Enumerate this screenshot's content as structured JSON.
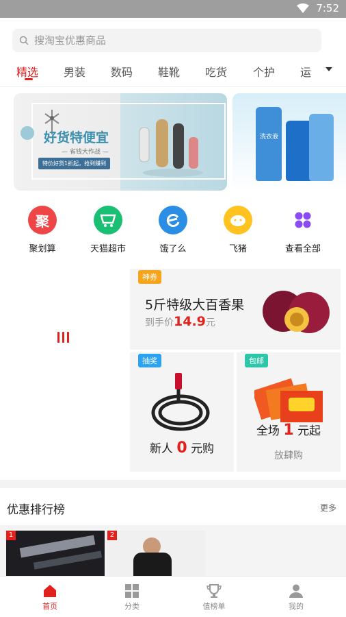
{
  "status_bar": {
    "time": "7:52"
  },
  "search": {
    "placeholder": "搜淘宝优惠商品"
  },
  "tabs": [
    {
      "label": "精选"
    },
    {
      "label": "男装"
    },
    {
      "label": "数码"
    },
    {
      "label": "鞋靴"
    },
    {
      "label": "吃货"
    },
    {
      "label": "个护"
    },
    {
      "label": "运动"
    }
  ],
  "banner": {
    "title": "好货特便宜",
    "subtitle": "— 省钱大作战 —",
    "tag": "特价好货1折起，抢到赚到",
    "banner2_text": "洗衣液"
  },
  "quick_nav": [
    {
      "label": "聚划算",
      "icon_text": "聚",
      "color": "#ee4646"
    },
    {
      "label": "天猫超市",
      "color": "#19bf72"
    },
    {
      "label": "饿了么",
      "color": "#2a8ee5"
    },
    {
      "label": "飞猪",
      "color": "#ffc21e"
    },
    {
      "label": "查看全部",
      "color": "#8a4cf2"
    }
  ],
  "promo": {
    "big": {
      "badge": "神券",
      "title": "5斤特级大百香果",
      "price_prefix": "到手价",
      "price": "14.9",
      "price_unit": "元"
    },
    "card1": {
      "badge": "抽奖",
      "title_pre": "新人",
      "title_num": "0",
      "title_post": "元购"
    },
    "card2": {
      "badge": "包邮",
      "title_pre": "全场",
      "title_num": "1",
      "title_post": "元起",
      "sub": "放肆购"
    }
  },
  "ranking": {
    "title": "优惠排行榜",
    "more": "更多",
    "items": [
      {
        "rank": "1"
      },
      {
        "rank": "2"
      }
    ]
  },
  "bottom_nav": [
    {
      "label": "首页"
    },
    {
      "label": "分类"
    },
    {
      "label": "值榜单"
    },
    {
      "label": "我的"
    }
  ],
  "colors": {
    "accent": "#e2211c",
    "status_bar": "#9e9e9e"
  }
}
